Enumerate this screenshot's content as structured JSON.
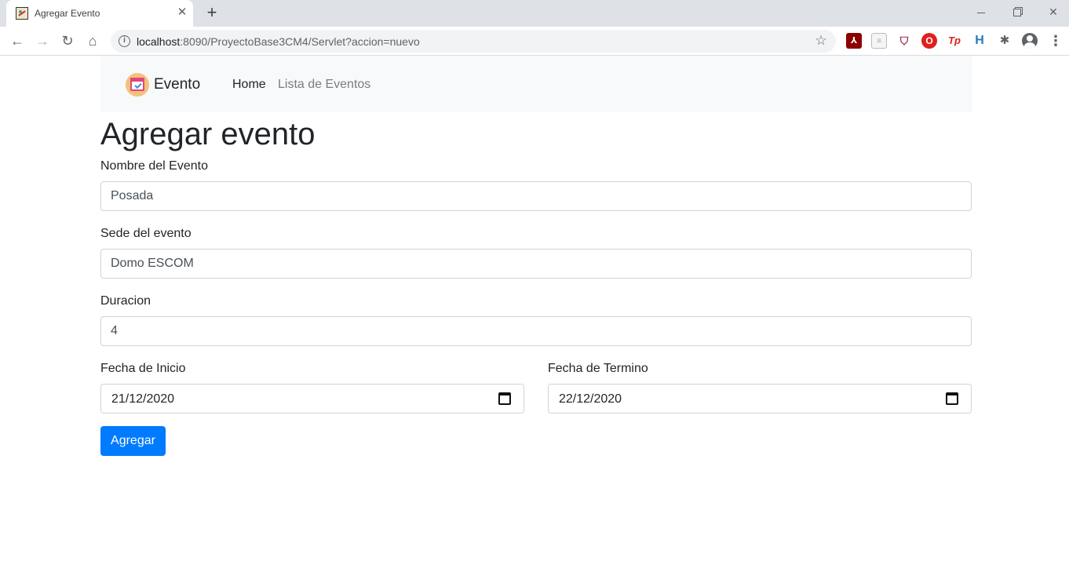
{
  "browser": {
    "tab_title": "Agregar Evento",
    "url_host": "localhost",
    "url_path": ":8090/ProyectoBase3CM4/Servlet?accion=nuevo"
  },
  "navbar": {
    "brand": "Evento",
    "links": [
      "Home",
      "Lista de Eventos"
    ]
  },
  "page": {
    "title": "Agregar evento"
  },
  "form": {
    "nombre_label": "Nombre del Evento",
    "nombre_value": "Posada",
    "sede_label": "Sede del evento",
    "sede_value": "Domo ESCOM",
    "duracion_label": "Duracion",
    "duracion_value": "4",
    "fecha_inicio_label": "Fecha de Inicio",
    "fecha_inicio_value": "21/12/2020",
    "fecha_termino_label": "Fecha de Termino",
    "fecha_termino_value": "22/12/2020",
    "submit_label": "Agregar"
  },
  "colors": {
    "primary": "#007bff",
    "navbar_bg": "#f8f9fa",
    "text": "#212529",
    "muted_link": "#7a7d80"
  },
  "icons": {
    "tab_favicon": "app-favicon-icon",
    "calendar": "calendar-icon",
    "brand_logo": "calendar-check-icon"
  }
}
